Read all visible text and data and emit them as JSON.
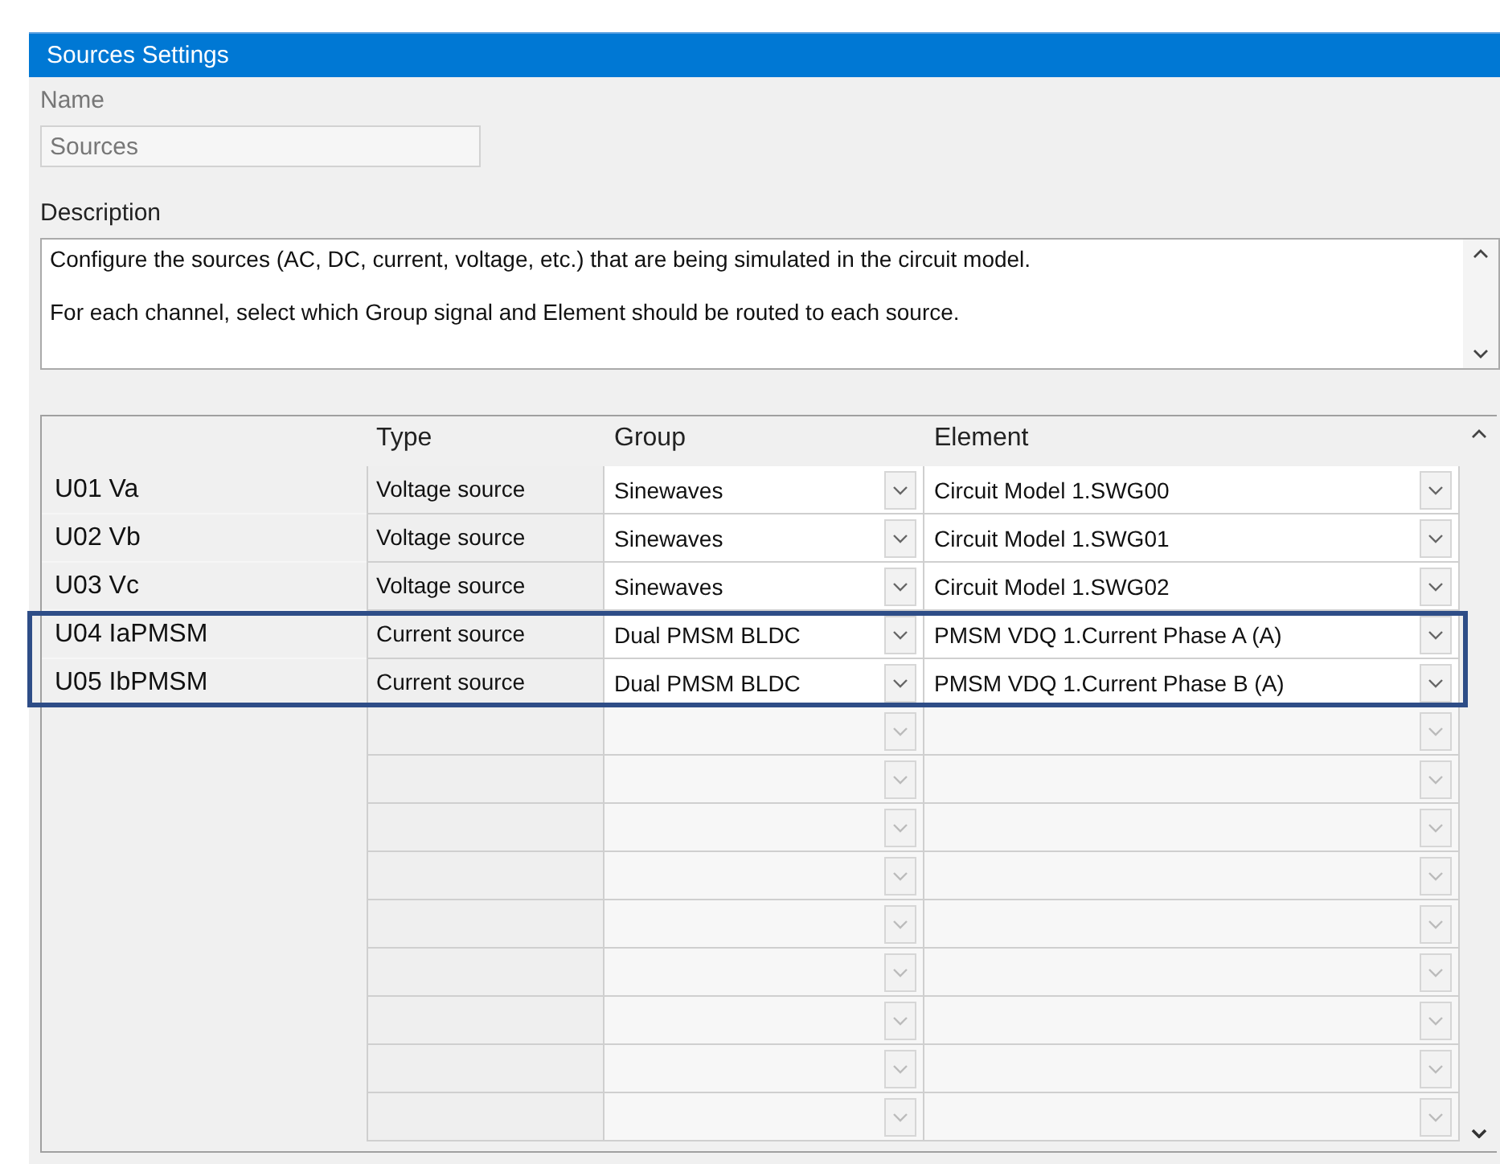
{
  "panel": {
    "title": "Sources Settings"
  },
  "name": {
    "label": "Name",
    "value": "Sources"
  },
  "description": {
    "label": "Description",
    "lines": [
      "Configure the sources (AC, DC, current, voltage, etc.) that are being simulated in the circuit model.",
      "For each channel, select which Group signal and Element should be routed to each source."
    ]
  },
  "table": {
    "columns": [
      "Type",
      "Group",
      "Element"
    ],
    "rows": [
      {
        "kind": "source",
        "label": "U01 Va",
        "type": "Voltage source",
        "group": "Sinewaves",
        "element": "Circuit Model 1.SWG00",
        "highlighted": false
      },
      {
        "kind": "source",
        "label": "U02 Vb",
        "type": "Voltage source",
        "group": "Sinewaves",
        "element": "Circuit Model 1.SWG01",
        "highlighted": false
      },
      {
        "kind": "source",
        "label": "U03 Vc",
        "type": "Voltage source",
        "group": "Sinewaves",
        "element": "Circuit Model 1.SWG02",
        "highlighted": false
      },
      {
        "kind": "source",
        "label": "U04 IaPMSM",
        "type": "Current source",
        "group": "Dual PMSM BLDC",
        "element": "PMSM VDQ 1.Current Phase A (A)",
        "highlighted": true
      },
      {
        "kind": "source",
        "label": "U05 IbPMSM",
        "type": "Current source",
        "group": "Dual PMSM BLDC",
        "element": "PMSM VDQ 1.Current Phase B (A)",
        "highlighted": true
      },
      {
        "kind": "blank"
      },
      {
        "kind": "blank"
      },
      {
        "kind": "blank"
      },
      {
        "kind": "blank"
      },
      {
        "kind": "blank"
      },
      {
        "kind": "blank"
      },
      {
        "kind": "blank"
      },
      {
        "kind": "blank"
      },
      {
        "kind": "blank"
      }
    ]
  }
}
